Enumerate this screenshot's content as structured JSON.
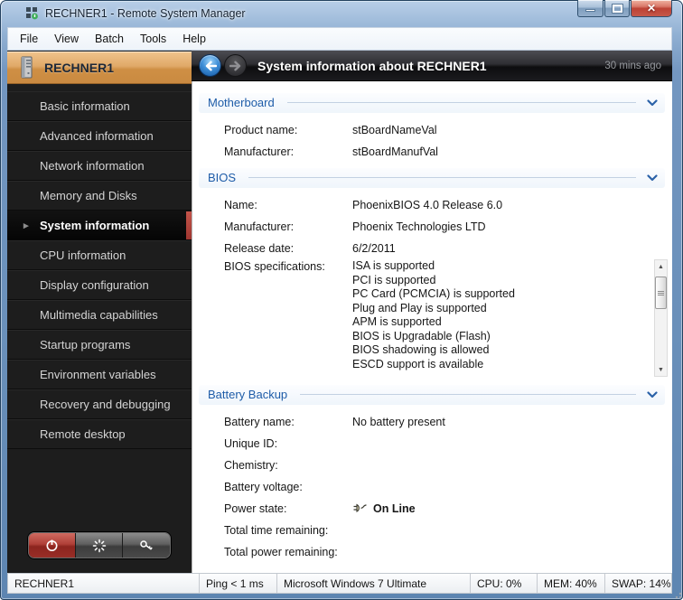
{
  "window": {
    "title": "RECHNER1 - Remote System Manager"
  },
  "menu": {
    "items": [
      {
        "label": "File"
      },
      {
        "label": "View"
      },
      {
        "label": "Batch"
      },
      {
        "label": "Tools"
      },
      {
        "label": "Help"
      }
    ]
  },
  "sidebar": {
    "header_label": "RECHNER1",
    "items": [
      {
        "label": "Basic information"
      },
      {
        "label": "Advanced information"
      },
      {
        "label": "Network information"
      },
      {
        "label": "Memory and Disks"
      },
      {
        "label": "System information",
        "selected": true
      },
      {
        "label": "CPU information"
      },
      {
        "label": "Display configuration"
      },
      {
        "label": "Multimedia capabilities"
      },
      {
        "label": "Startup programs"
      },
      {
        "label": "Environment variables"
      },
      {
        "label": "Recovery and debugging"
      },
      {
        "label": "Remote desktop"
      }
    ]
  },
  "content": {
    "header": {
      "title": "System information about RECHNER1",
      "timestamp": "30 mins ago"
    },
    "sections": [
      {
        "title": "Motherboard",
        "rows": [
          {
            "label": "Product name:",
            "value": "stBoardNameVal"
          },
          {
            "label": "Manufacturer:",
            "value": "stBoardManufVal"
          }
        ]
      },
      {
        "title": "BIOS",
        "rows": [
          {
            "label": "Name:",
            "value": "PhoenixBIOS 4.0 Release 6.0"
          },
          {
            "label": "Manufacturer:",
            "value": "Phoenix Technologies LTD"
          },
          {
            "label": "Release date:",
            "value": "6/2/2011"
          }
        ],
        "list_label": "BIOS specifications:",
        "list_items": [
          "ISA is supported",
          "PCI is supported",
          "PC Card (PCMCIA) is supported",
          "Plug and Play is supported",
          "APM is supported",
          "BIOS is Upgradable (Flash)",
          "BIOS shadowing is allowed",
          "ESCD support is available"
        ]
      },
      {
        "title": "Battery Backup",
        "rows": [
          {
            "label": "Battery name:",
            "value": "No battery present"
          },
          {
            "label": "Unique ID:",
            "value": ""
          },
          {
            "label": "Chemistry:",
            "value": ""
          },
          {
            "label": "Battery voltage:",
            "value": ""
          },
          {
            "label": "Power state:",
            "value": "On Line"
          },
          {
            "label": "Total time remaining:",
            "value": ""
          },
          {
            "label": "Total power remaining:",
            "value": ""
          }
        ]
      }
    ]
  },
  "statusbar": {
    "cells": [
      {
        "text": "RECHNER1"
      },
      {
        "text": "Ping < 1 ms"
      },
      {
        "text": "Microsoft Windows 7 Ultimate"
      },
      {
        "text": "CPU: 0%"
      },
      {
        "text": "MEM: 40%"
      },
      {
        "text": "SWAP: 14%"
      }
    ]
  },
  "colors": {
    "aero_blue": "#6a90ba",
    "sidebar_header_orange": "#d89a55",
    "selected_red": "#b03a36",
    "section_heading_blue": "#1e5ca8"
  }
}
